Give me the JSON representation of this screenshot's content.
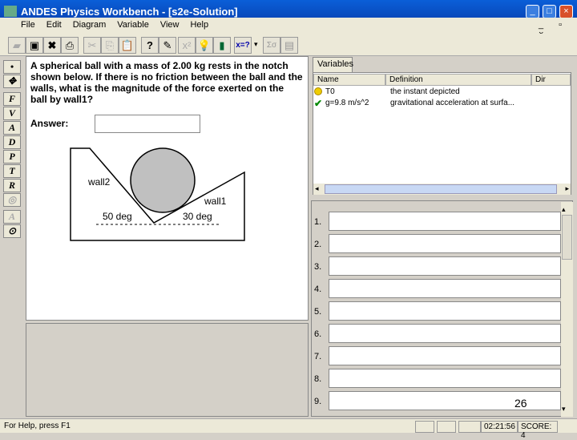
{
  "window": {
    "title": "ANDES Physics Workbench - [s2e-Solution]"
  },
  "menu": [
    "File",
    "Edit",
    "Diagram",
    "Variable",
    "View",
    "Help"
  ],
  "toolbar": {
    "buttons": [
      "open",
      "save",
      "delete",
      "print",
      "cut",
      "copy",
      "paste",
      "whats-wrong",
      "next-step",
      "calculator",
      "hint",
      "review",
      "answer-unknown",
      "sum",
      "solve"
    ],
    "unknown_label": "x=?",
    "sum_label": "Σσ"
  },
  "tools": [
    "•",
    "✥",
    "F",
    "V",
    "A",
    "D",
    "P",
    "T",
    "R",
    "◎",
    "A",
    "⊙"
  ],
  "problem": {
    "text": "A spherical ball with a mass of 2.00 kg rests in the notch shown below.  If there is no friction between the ball and the walls, what is the magnitude of the force exerted on the ball by wall1?",
    "answer_label": "Answer:",
    "answer_value": "",
    "diagram": {
      "wall2": "wall2",
      "wall1": "wall1",
      "angle_left": "50 deg",
      "angle_right": "30 deg"
    }
  },
  "variables": {
    "tab": "Variables",
    "columns": [
      "Name",
      "Definition",
      "Dir"
    ],
    "rows": [
      {
        "name": "T0",
        "definition": "the instant depicted",
        "status": "smiley"
      },
      {
        "name": "g=9.8 m/s^2",
        "definition": "gravitational acceleration at surfa...",
        "status": "check"
      }
    ]
  },
  "equations": {
    "numbers": [
      "1.",
      "2.",
      "3.",
      "4.",
      "5.",
      "6.",
      "7.",
      "8.",
      "9."
    ],
    "overlay": "26"
  },
  "status": {
    "help": "For Help, press F1",
    "time": "02:21:56",
    "score": "SCORE: 4"
  }
}
